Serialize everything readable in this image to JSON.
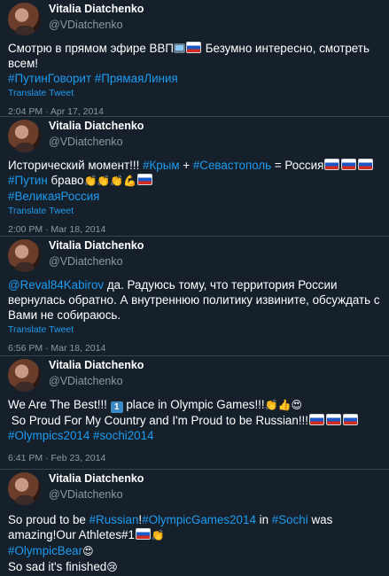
{
  "translate_label": "Translate Tweet",
  "tweets": [
    {
      "name": "Vitalia Diatchenko",
      "handle": "@VDiatchenko",
      "meta": "2:04 PM · Apr 17, 2014",
      "text": {
        "t1": "Смотрю в прямом эфире ВВП",
        "t2": " Безумно интересно, смотреть всем!",
        "h1": "#ПутинГоворит",
        "h2": "#ПрямаяЛиния"
      }
    },
    {
      "name": "Vitalia Diatchenko",
      "handle": "@VDiatchenko",
      "meta": "2:00 PM · Mar 18, 2014",
      "text": {
        "t1": "Исторический момент!!! ",
        "h1": "#Крым",
        "t2": " + ",
        "h2": "#Севастополь",
        "t3": " = Россия",
        "h3": "#Путин",
        "t4": " браво",
        "h4": "#ВеликаяРоссия"
      }
    },
    {
      "name": "Vitalia Diatchenko",
      "handle": "@VDiatchenko",
      "meta": "6:56 PM · Mar 18, 2014",
      "text": {
        "m1": "@Reval84Kabirov",
        "t1": " да. Радуюсь тому, что территория России вернулась обратно. А внутреннюю политику извините, обсуждать с Вами не собираюсь."
      }
    },
    {
      "name": "Vitalia Diatchenko",
      "handle": "@VDiatchenko",
      "meta": "6:41 PM · Feb 23, 2014",
      "text": {
        "t1": "We Are The Best!!! ",
        "k1": "1",
        "t2": " place in Olympic Games!!!",
        "t3": " So Proud For My Country and I'm Proud to be Russian!!!",
        "h1": "#Olympics2014",
        "h2": "#sochi2014"
      }
    },
    {
      "name": "Vitalia Diatchenko",
      "handle": "@VDiatchenko",
      "text": {
        "t1": "So proud to be ",
        "h1": "#Russian",
        "t2": "!",
        "h2": "#OlympicGames2014",
        "t3": " in ",
        "h3": "#Sochi",
        "t4": " was amazing!Our Athletes#1",
        "h4": "#OlympicBear",
        "t5": "So sad it's finished"
      }
    }
  ],
  "icons": [
    "tv-icon",
    "russia-flag-icon",
    "clapping-hands-icon",
    "flexed-biceps-icon",
    "thumbs-up-icon",
    "heart-eyes-icon",
    "keycap-one-icon",
    "sad-face-icon"
  ]
}
